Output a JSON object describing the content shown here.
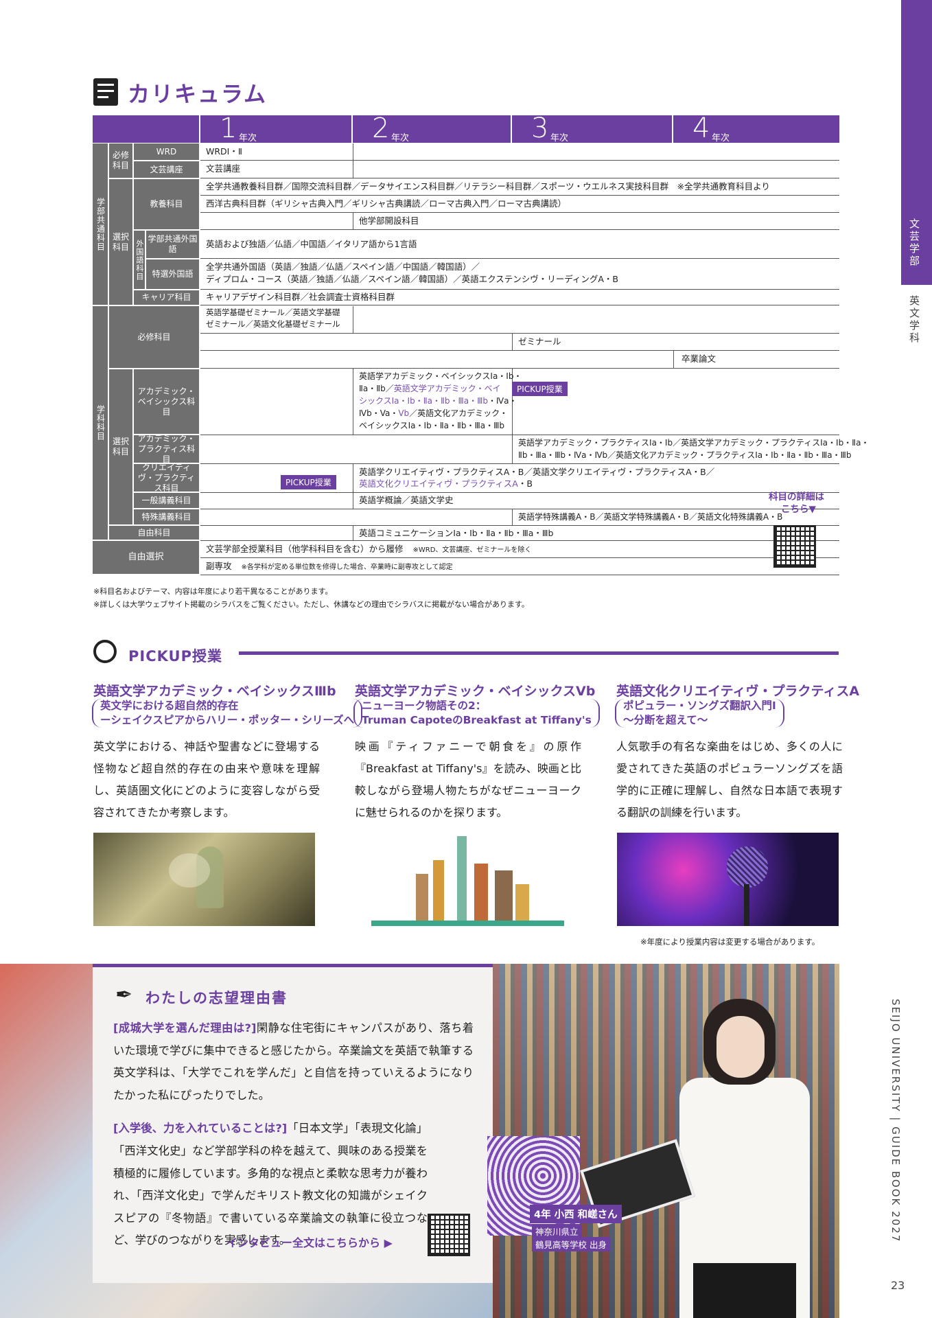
{
  "side": {
    "faculty": "文芸学部",
    "dept": "英文学科"
  },
  "curriculum": {
    "title": "カリキュラム",
    "years": [
      {
        "num": "1",
        "label": "年次"
      },
      {
        "num": "2",
        "label": "年次"
      },
      {
        "num": "3",
        "label": "年次"
      },
      {
        "num": "4",
        "label": "年次"
      }
    ],
    "groups": {
      "common": "学部共通科目",
      "major": "学科科目",
      "free_select": "自由選択"
    },
    "sub": {
      "hissyu": "必修科目",
      "sentaku": "選択科目",
      "gaikoku": "外国語科目",
      "hissyu2": "必修科目",
      "sentaku2": "選択科目",
      "jiyu": "自由科目"
    },
    "labels": {
      "wrd": "WRD",
      "bungei": "文芸講座",
      "kyoyo": "教養科目",
      "gakubu_gaikoku": "学部共通外国語",
      "tokusen": "特選外国語",
      "career": "キャリア科目",
      "academic": "アカデミック・ベイシックス科目",
      "ac_practice": "アカデミック・プラクティス科目",
      "creative": "クリエイティヴ・プラクティス科目",
      "ippan": "一般講義科目",
      "tokushu": "特殊講義科目"
    },
    "cells": {
      "wrd": "WRDⅠ・Ⅱ",
      "bungei": "文芸講座",
      "kyoyo1": "全学共通教養科目群／国際交流科目群／データサイエンス科目群／リテラシー科目群／スポーツ・ウエルネス実技科目群　※全学共通教育科目より",
      "kyoyo2": "西洋古典科目群（ギリシャ古典入門／ギリシャ古典講読／ローマ古典入門／ローマ古典講読）",
      "kyoyo3": "他学部開設科目",
      "gaikoku1": "英語および独語／仏語／中国語／イタリア語から1言語",
      "tokusen1": "全学共通外国語（英語／独語／仏語／スペイン語／中国語／韓国語）／",
      "tokusen2": "ディプロム・コース（英語／独語／仏語／スペイン語／韓国語）／英語エクステンシヴ・リーディングA・B",
      "career": "キャリアデザイン科目群／社会調査士資格科目群",
      "kiso1": "英語学基礎ゼミナール／英語文学基礎",
      "kiso2": "ゼミナール／英語文化基礎ゼミナール",
      "seminar": "ゼミナール",
      "sotsuron": "卒業論文",
      "ab1": "英語学アカデミック・ベイシックスⅠa・Ⅰb・",
      "ab2a": "Ⅱa・Ⅱb／",
      "ab2b": "英語文学アカデミック・ベイ",
      "ab3a": "シックスⅠa・Ⅰb・Ⅱa・Ⅱb・Ⅲa・",
      "ab3b": "Ⅲb",
      "ab3c": "・Ⅳa・",
      "ab4a": "Ⅳb・Va・",
      "ab4b": "Vb",
      "ab4c": "／英語文化アカデミック・",
      "ab5": "ベイシックスⅠa・Ⅰb・Ⅱa・Ⅱb・Ⅲa・Ⅲb",
      "ap1": "英語学アカデミック・プラクティスⅠa・Ⅰb／英語文学アカデミック・プラクティスⅠa・Ⅰb・Ⅱa・",
      "ap2": "Ⅱb・Ⅲa・Ⅲb・Ⅳa・Ⅳb／英語文化アカデミック・プラクティスⅠa・Ⅰb・Ⅱa・Ⅱb・Ⅲa・Ⅲb",
      "cp1": "英語学クリエイティヴ・プラクティスA・B／英語文学クリエイティヴ・プラクティスA・B／",
      "cp2": "英語文化クリエイティヴ・プラクティスA",
      "cp2b": "・B",
      "ippan": "英語学概論／英語文学史",
      "tokushu": "英語学特殊講義A・B／英語文学特殊講義A・B／英語文化特殊講義A・B",
      "jiyu": "英語コミュニケーションⅠa・Ⅰb・Ⅱa・Ⅱb・Ⅲa・Ⅲb",
      "free1": "文芸学部全授業科目（他学科科目を含む）から履修",
      "free1_note": "※WRD、文芸講座、ゼミナールを除く",
      "free2": "副専攻",
      "free2_note": "※各学科が定める単位数を修得した場合、卒業時に副専攻として認定"
    },
    "pickup_tag": "PICKUP授業",
    "detail": "科目の詳細は",
    "detail2": "こちら▼",
    "note1": "※科目名およびテーマ、内容は年度により若干異なることがあります。",
    "note2": "※詳しくは大学ウェブサイト掲載のシラバスをご覧ください。ただし、休講などの理由でシラバスに掲載がない場合があります。"
  },
  "pickup": {
    "title": "PICKUP授業",
    "items": [
      {
        "head": "英語文学アカデミック・ベイシックスⅢb",
        "sub1": "英文学における超自然的存在",
        "sub2": "ーシェイクスピアからハリー・ポッター・シリーズへ",
        "body": "英文学における、神話や聖書などに登場する怪物など超自然的存在の由来や意味を理解し、英語圏文化にどのように変容しながら受容されてきたか考察します。"
      },
      {
        "head": "英語文学アカデミック・ベイシックスVb",
        "sub1": "ニューヨーク物語その2：",
        "sub2": "Truman CapoteのBreakfast at Tiffany's",
        "body": "映画『ティファニーで朝食を』の原作『Breakfast at Tiffany's』を読み、映画と比較しながら登場人物たちがなぜニューヨークに魅せられるのかを探ります。"
      },
      {
        "head": "英語文化クリエイティヴ・プラクティスA",
        "sub1": "ポピュラー・ソングズ翻訳入門Ⅰ",
        "sub2": "〜分断を超えて〜",
        "body": "人気歌手の有名な楽曲をはじめ、多くの人に愛されてきた英語のポピュラーソングズを語学的に正確に理解し、自然な日本語で表現する翻訳の訓練を行います。"
      }
    ],
    "note": "※年度により授業内容は変更する場合があります。"
  },
  "essay": {
    "title": "わたしの志望理由書",
    "q1": "[成城大学を選んだ理由は?]",
    "a1": "閑静な住宅街にキャンパスがあり、落ち着いた環境で学びに集中できると感じたから。卒業論文を英語で執筆する英文学科は、「大学でこれを学んだ」と自信を持っていえるようになりたかった私にぴったりでした。",
    "q2": "[入学後、力を入れていることは?]",
    "a2": "「日本文学」「表現文化論」「西洋文化史」など学部学科の枠を越えて、興味のある授業を積極的に履修しています。多角的な視点と柔軟な思考力が養われ、「西洋文化史」で学んだキリスト教文化の知識がシェイクスピアの『冬物語』で書いている卒業論文の執筆に役立つなど、学びのつながりを実感します。",
    "interview": "インタビュー全文はこちらから ▶",
    "name": "4年 小西 和嵯さん",
    "school1": "神奈川県立",
    "school2": "鶴見高等学校 出身"
  },
  "brand": "SEIJO UNIVERSITY | GUIDE BOOK 2027",
  "page": "23",
  "colors": {
    "accent": "#6b3fa0",
    "gray": "#6f6f6f"
  }
}
